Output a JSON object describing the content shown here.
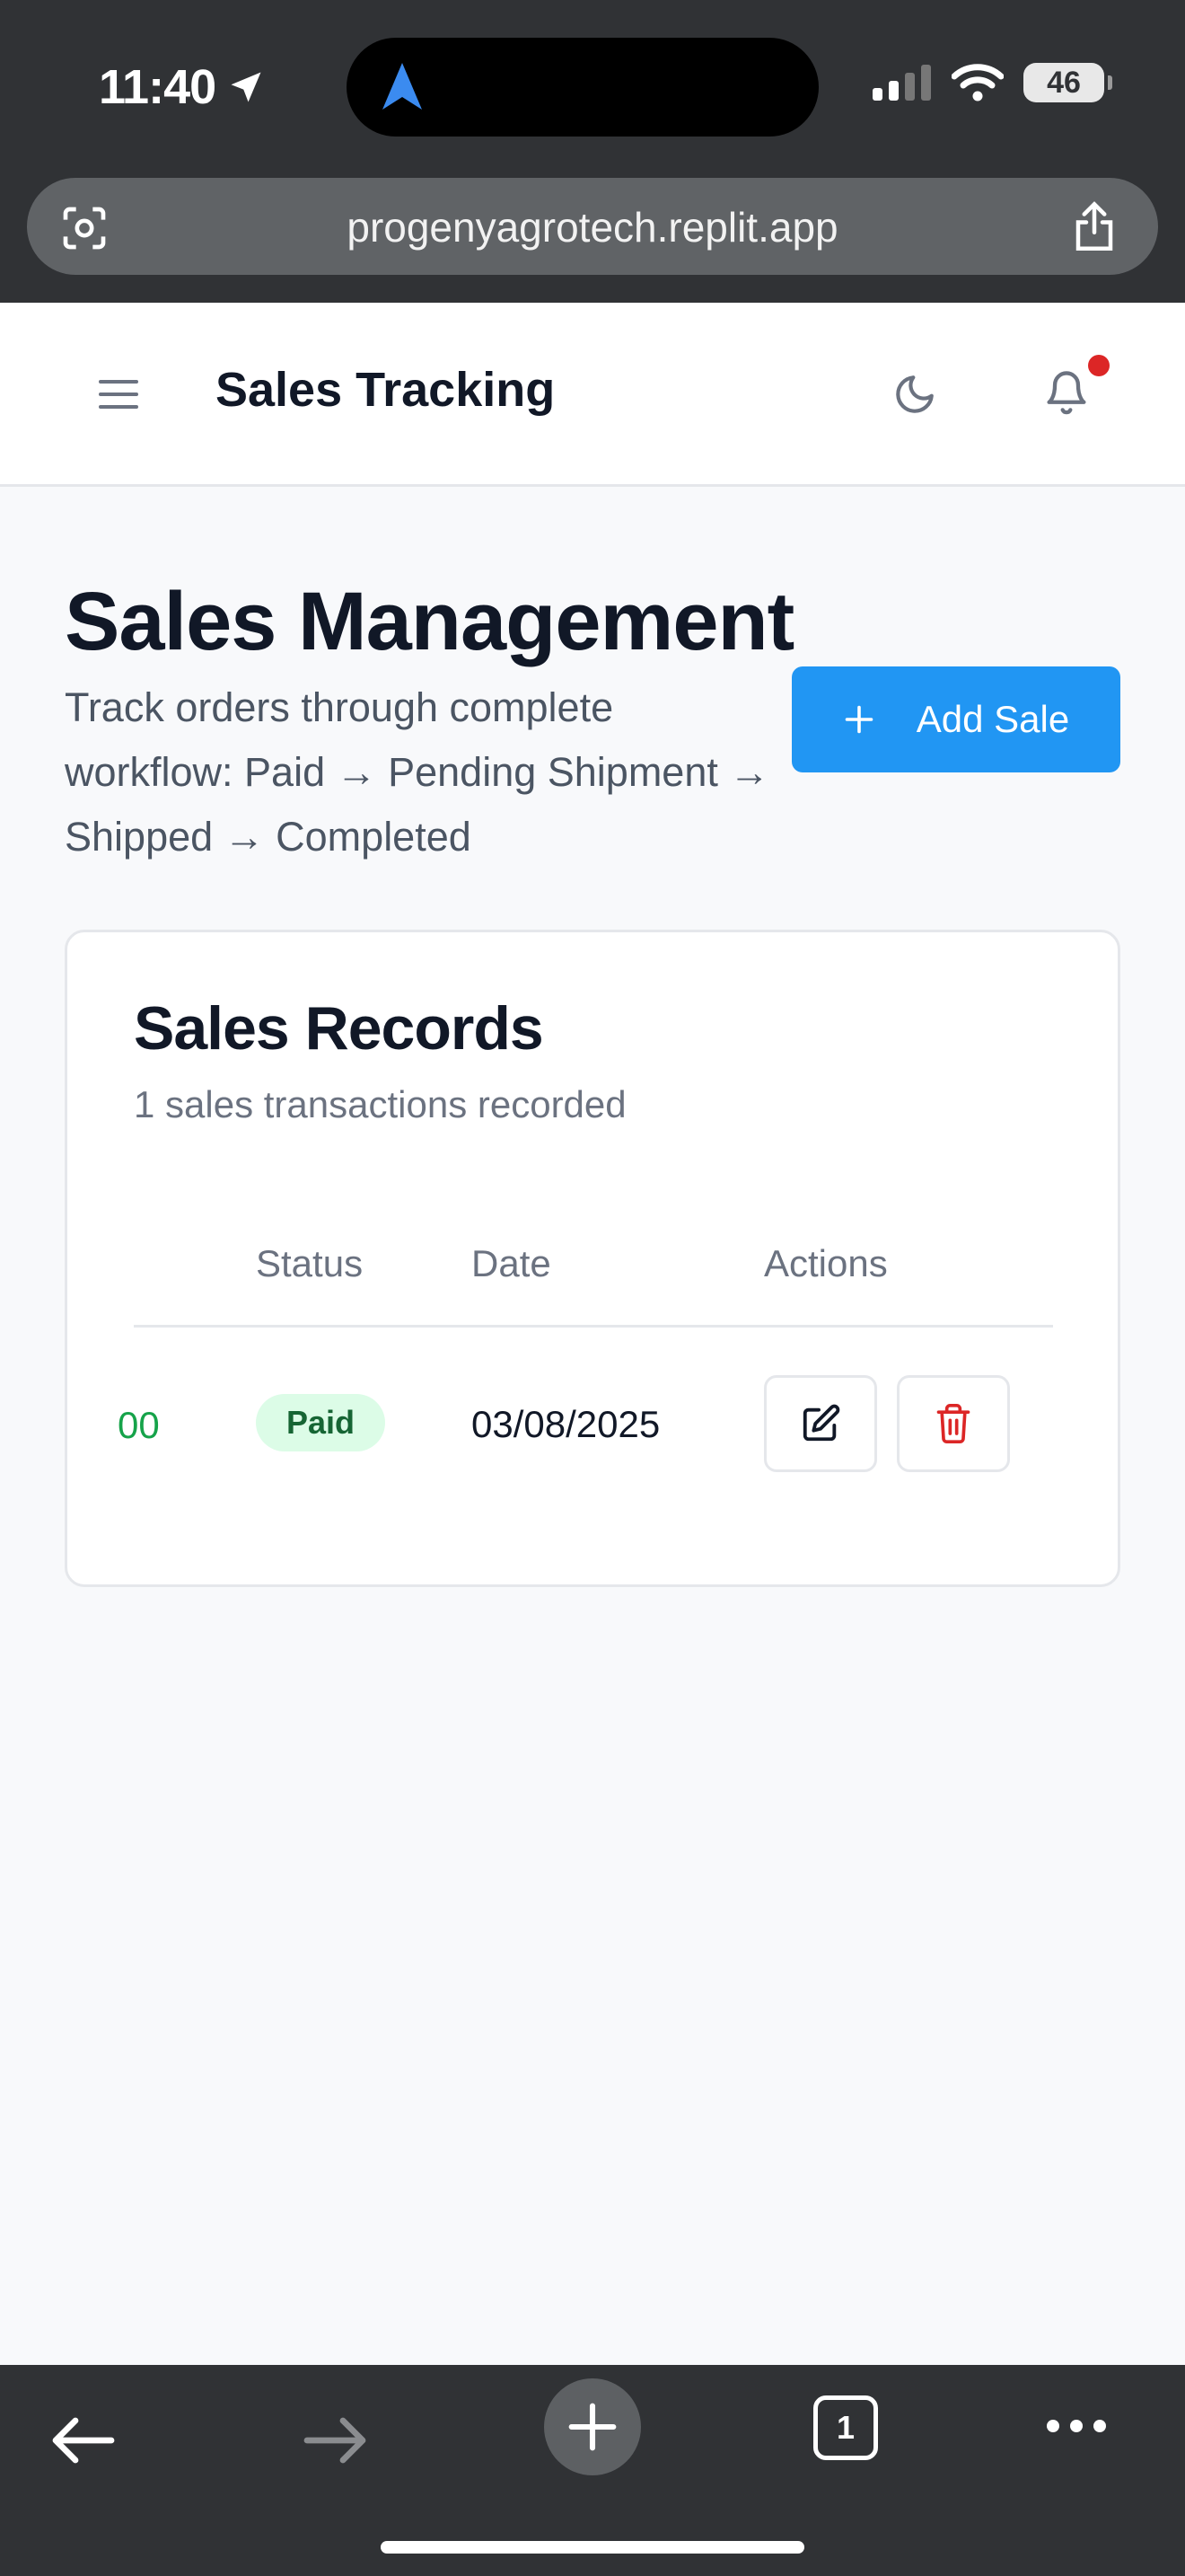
{
  "status_bar": {
    "time": "11:40",
    "battery": "46"
  },
  "browser": {
    "url": "progenyagrotech.replit.app",
    "tab_count": "1"
  },
  "header": {
    "title": "Sales Tracking"
  },
  "page": {
    "title": "Sales Management",
    "subtitle": "Track orders through complete workflow: Paid → Pending Shipment → Shipped → Completed",
    "add_button_label": "Add Sale"
  },
  "sales_records": {
    "title": "Sales Records",
    "subtitle": "1 sales transactions recorded",
    "columns": [
      "Status",
      "Date",
      "Actions"
    ],
    "rows": [
      {
        "amount": "00",
        "status": "Paid",
        "date": "03/08/2025"
      }
    ]
  },
  "colors": {
    "accent": "#2196f3",
    "paid_badge_bg": "#dcfce7",
    "paid_badge_text": "#166534",
    "amount_green": "#16a34a",
    "delete_red": "#dc2626",
    "notification_dot": "#dc2626"
  },
  "icons": {
    "menu": "menu-icon",
    "theme": "moon-icon",
    "notifications": "bell-icon",
    "add": "plus-icon",
    "edit": "edit-icon",
    "delete": "trash-icon"
  }
}
